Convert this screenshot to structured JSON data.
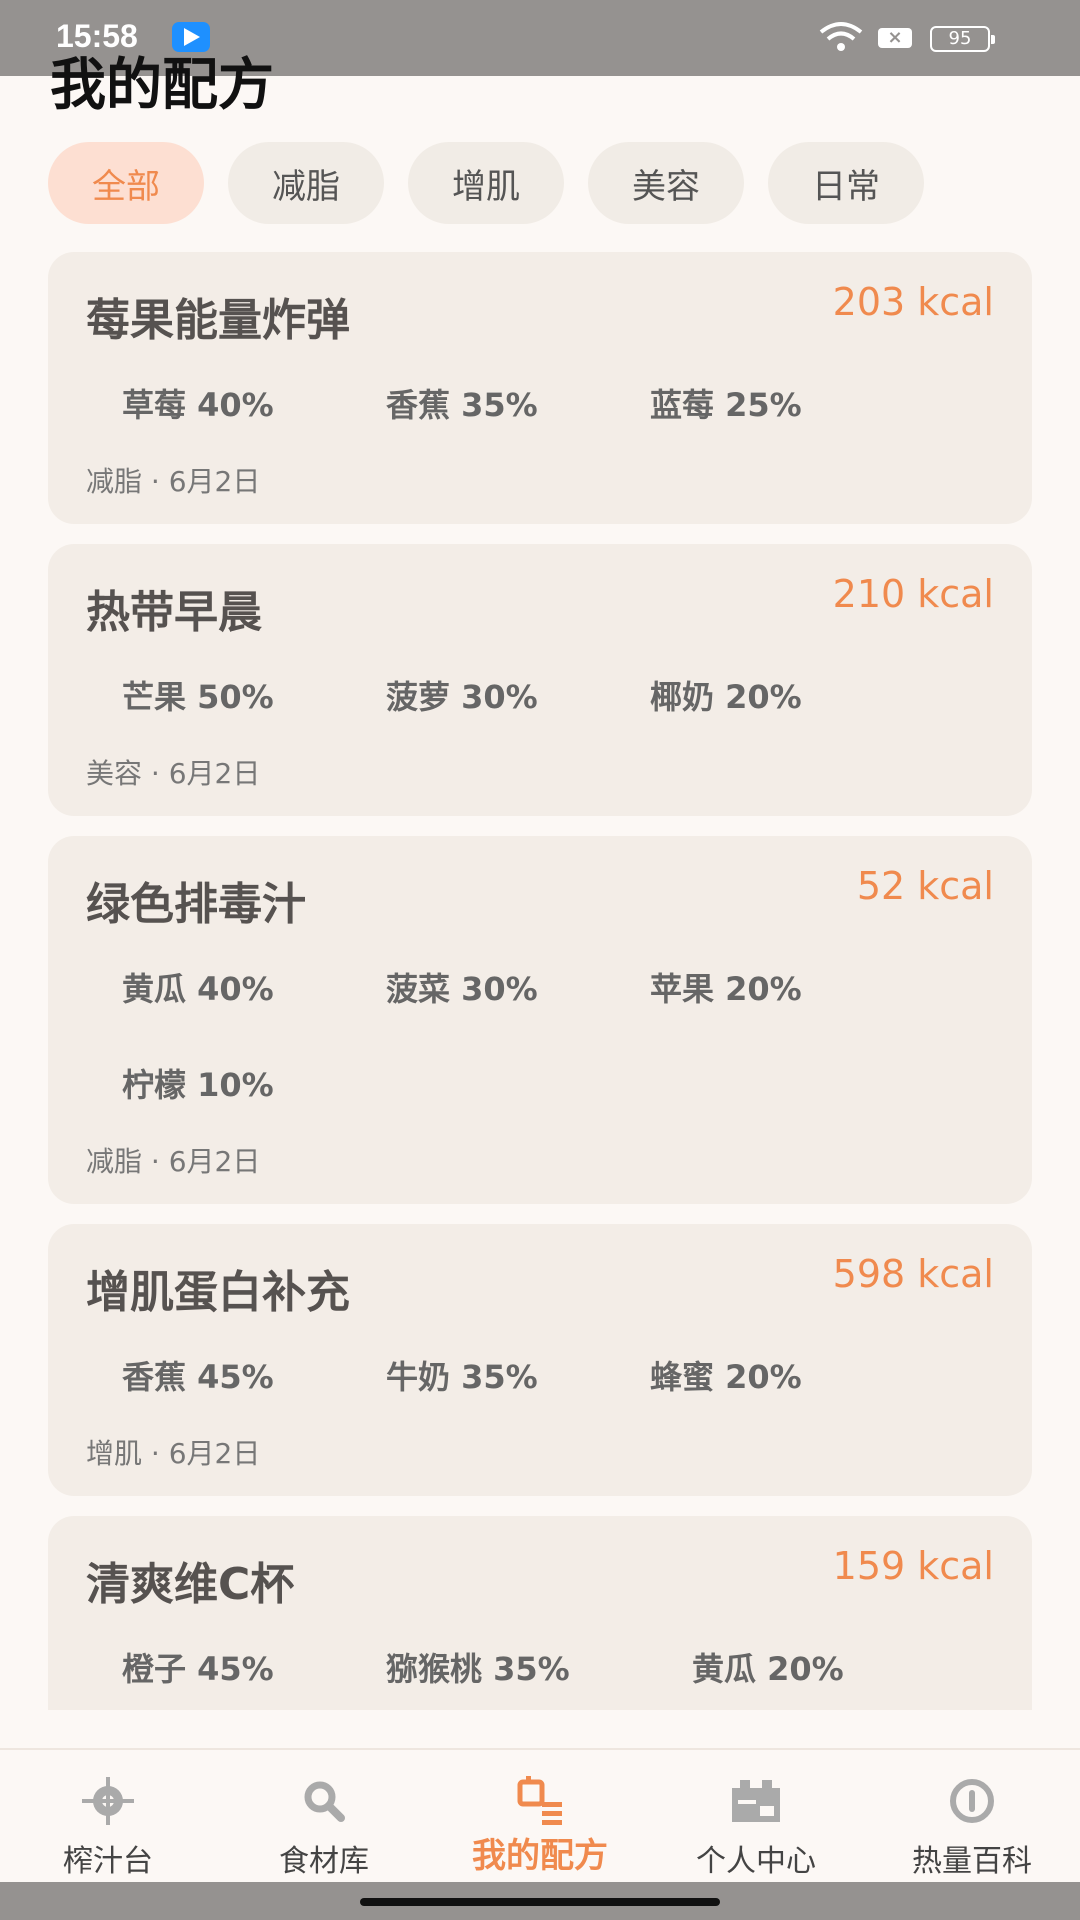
{
  "status": {
    "time": "15:58",
    "battery": "95"
  },
  "page": {
    "title": "我的配方"
  },
  "filters": [
    {
      "label": "全部",
      "active": true
    },
    {
      "label": "减脂",
      "active": false
    },
    {
      "label": "增肌",
      "active": false
    },
    {
      "label": "美容",
      "active": false
    },
    {
      "label": "日常",
      "active": false
    }
  ],
  "recipes": [
    {
      "name": "莓果能量炸弹",
      "kcal": "203 kcal",
      "ingredients": [
        "草莓 40%",
        "香蕉 35%",
        "蓝莓 25%"
      ],
      "meta": "减脂 · 6月2日"
    },
    {
      "name": "热带早晨",
      "kcal": "210 kcal",
      "ingredients": [
        "芒果 50%",
        "菠萝 30%",
        "椰奶 20%"
      ],
      "meta": "美容 · 6月2日"
    },
    {
      "name": "绿色排毒汁",
      "kcal": "52 kcal",
      "ingredients": [
        "黄瓜 40%",
        "菠菜 30%",
        "苹果 20%",
        "柠檬 10%"
      ],
      "meta": "减脂 · 6月2日"
    },
    {
      "name": "增肌蛋白补充",
      "kcal": "598 kcal",
      "ingredients": [
        "香蕉 45%",
        "牛奶 35%",
        "蜂蜜 20%"
      ],
      "meta": "增肌 · 6月2日"
    },
    {
      "name": "清爽维C杯",
      "kcal": "159 kcal",
      "ingredients": [
        "橙子 45%",
        "猕猴桃 35%",
        "黄瓜 20%"
      ],
      "meta": ""
    }
  ],
  "nav": [
    {
      "label": "榨汁台",
      "icon": "target-icon",
      "active": false
    },
    {
      "label": "食材库",
      "icon": "search-icon",
      "active": false
    },
    {
      "label": "我的配方",
      "icon": "recipe-list-icon",
      "active": true
    },
    {
      "label": "个人中心",
      "icon": "profile-icon",
      "active": false
    },
    {
      "label": "热量百科",
      "icon": "info-icon",
      "active": false
    }
  ],
  "colors": {
    "accent": "#f08a4e",
    "card": "#f3ede7",
    "chip_active": "#fddfd2"
  }
}
